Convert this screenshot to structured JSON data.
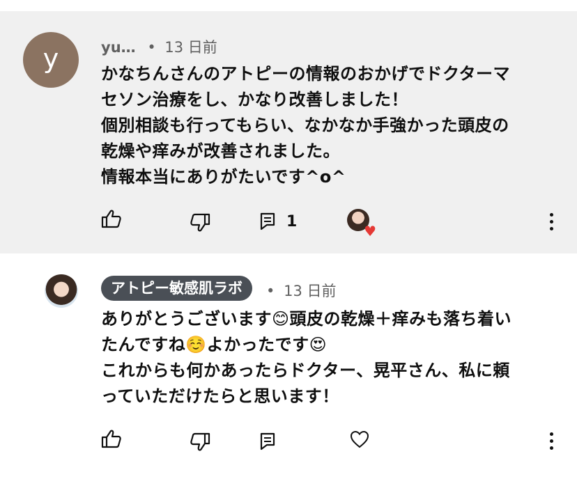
{
  "comments": [
    {
      "avatar_letter": "y",
      "author": "yu…",
      "separator": "•",
      "time": "13 日前",
      "body": "かなちんさんのアトピーの情報のおかげでドクターマ\nセソン治療をし、かなり改善しました！\n個別相談も行ってもらい、なかなか手強かった頭皮の\n乾燥や痒みが改善されました。\n情報本当にありがたいです^o^",
      "reply_count": "1",
      "icons": {
        "like": "thumbs-up-icon",
        "dislike": "thumbs-down-icon",
        "reply": "reply-icon",
        "creator_heart": "creator-heart-icon",
        "more": "more-vertical-icon"
      }
    },
    {
      "author": "アトピー敏感肌ラボ",
      "separator": "•",
      "time": "13 日前",
      "body": "ありがとうございます😊頭皮の乾燥＋痒みも落ち着い\nたんですね☺️よかったです😍\nこれからも何かあったらドクター、晃平さん、私に頼\nっていただけたらと思います！",
      "icons": {
        "like": "thumbs-up-icon",
        "dislike": "thumbs-down-icon",
        "reply": "reply-icon",
        "heart": "heart-outline-icon",
        "more": "more-vertical-icon"
      }
    }
  ],
  "colors": {
    "highlight_bg": "#f0f0f0",
    "letter_avatar_bg": "#8b7361",
    "channel_badge_bg": "#4a4f56",
    "heart_red": "#e53935"
  }
}
